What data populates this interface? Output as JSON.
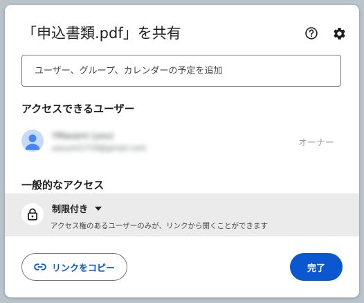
{
  "dialog": {
    "title": "「申込書類.pdf」を共有",
    "icons": {
      "help": "help-circle-icon",
      "settings": "gear-icon"
    }
  },
  "add_people": {
    "placeholder": "ユーザー、グループ、カレンダーの予定を追加"
  },
  "people_section": {
    "heading": "アクセスできるユーザー",
    "people": [
      {
        "name": "YMasami (you)",
        "email": "yasumi1719@gmail.com",
        "role": "オーナー",
        "avatar_icon": "person-icon"
      }
    ]
  },
  "general_access": {
    "heading": "一般的なアクセス",
    "lock_icon": "lock-icon",
    "selected": "制限付き",
    "description": "アクセス権のあるユーザーのみが、リンクから開くことができます"
  },
  "footer": {
    "copy_link_label": "リンクをコピー",
    "copy_link_icon": "link-icon",
    "done_label": "完了"
  },
  "colors": {
    "primary": "#0b57d0",
    "band": "#ebebeb",
    "avatar_bg": "#c6dafc",
    "avatar_fg": "#4285f4"
  }
}
